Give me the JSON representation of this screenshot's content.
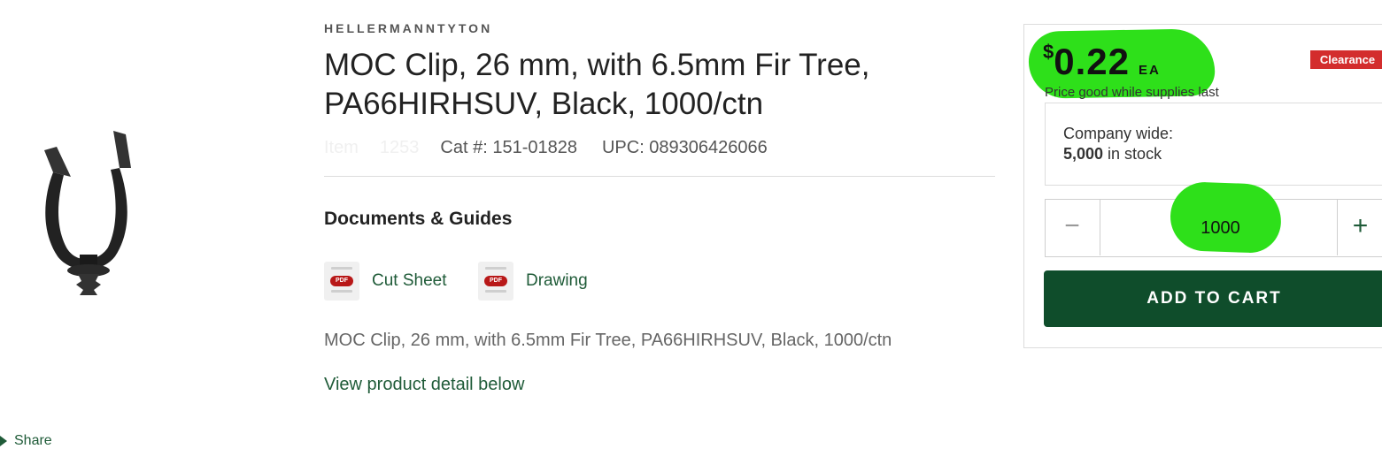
{
  "product": {
    "brand": "HELLERMANNTYTON",
    "title": "MOC Clip, 26 mm, with 6.5mm Fir Tree, PA66HIRHSUV, Black, 1000/ctn",
    "item_label_faded": "Item",
    "item_number_faded": "1253",
    "cat_number": "Cat #: 151-01828",
    "upc": "UPC: 089306426066",
    "description": "MOC Clip, 26 mm, with 6.5mm Fir Tree, PA66HIRHSUV, Black, 1000/ctn",
    "view_detail_link": "View product detail below",
    "share_label": "Share"
  },
  "documents": {
    "heading": "Documents & Guides",
    "items": [
      {
        "label": "Cut Sheet",
        "badge": "PDF"
      },
      {
        "label": "Drawing",
        "badge": "PDF"
      }
    ]
  },
  "buybox": {
    "currency_symbol": "$",
    "price": "0.22",
    "unit": "EA",
    "price_note": "Price good while supplies last",
    "clearance_badge": "Clearance",
    "stock_location_label": "Company wide:",
    "stock_count": "5,000",
    "stock_suffix": " in stock",
    "quantity_value": "1000",
    "minus_symbol": "−",
    "plus_symbol": "+",
    "add_to_cart_label": "ADD TO CART"
  },
  "colors": {
    "brand_green": "#0f4d2b",
    "link_green": "#1f5b38",
    "clearance_red": "#d32d2d",
    "annotation_highlight": "#2ee01a"
  },
  "icons": [
    "product-image",
    "pdf-icon",
    "share-icon",
    "minus-icon",
    "plus-icon"
  ]
}
